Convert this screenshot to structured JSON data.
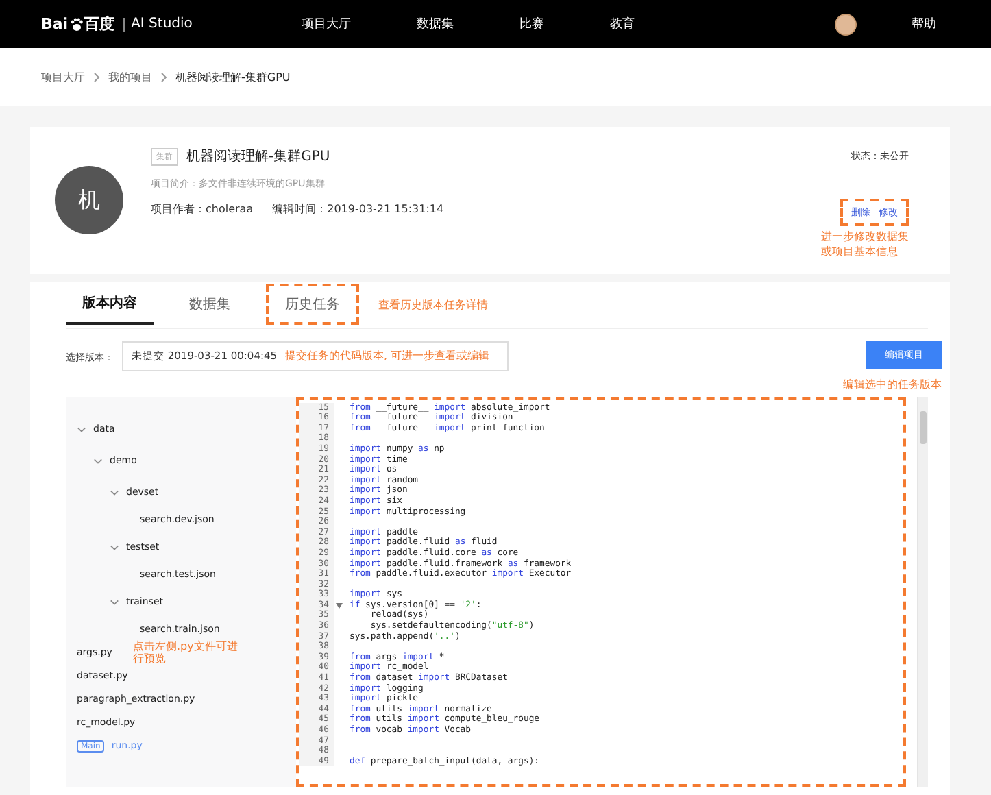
{
  "nav": {
    "logo_left": "Bai",
    "logo_right": "百度",
    "product": "AI Studio",
    "items": [
      {
        "label": "项目大厅",
        "selected": false
      },
      {
        "label": "数据集",
        "selected": false
      },
      {
        "label": "比赛",
        "selected": false
      },
      {
        "label": "教育",
        "selected": false
      }
    ],
    "help": "帮助"
  },
  "breadcrumb": [
    "项目大厅",
    "我的项目",
    "机器阅读理解-集群GPU"
  ],
  "project": {
    "avatar": "机",
    "tag": "集群",
    "title": "机器阅读理解-集群GPU",
    "summary": "项目简介：多文件非连续环境的GPU集群",
    "author": "项目作者：choleraa",
    "edited": "编辑时间：2019-03-21 15:31:14",
    "status": "状态：未公开",
    "actions": [
      "删除",
      "修改"
    ],
    "actions_annotated": true,
    "note_lines": [
      "进一步修改数据集",
      "或项目基本信息"
    ]
  },
  "tabs": [
    {
      "label": "版本内容",
      "selected": true,
      "annotated": false
    },
    {
      "label": "数据集",
      "selected": false,
      "annotated": false
    },
    {
      "label": "历史任务",
      "selected": false,
      "annotated": true
    }
  ],
  "tabs_note": "查看历史版本任务详情",
  "version": {
    "label": "选择版本：",
    "value": "未提交 2019-03-21 00:04:45",
    "note": "提交任务的代码版本, 可进一步查看或编辑",
    "button": "编辑项目",
    "button_note": "编辑选中的任务版本"
  },
  "files": [
    {
      "name": "data",
      "kind": "folder",
      "expanded": true,
      "selected": false,
      "children": [
        {
          "name": "demo",
          "kind": "folder",
          "expanded": true,
          "selected": false,
          "children": [
            {
              "name": "devset",
              "kind": "folder",
              "expanded": true,
              "selected": false,
              "children": [
                {
                  "name": "search.dev.json",
                  "kind": "file",
                  "selected": false
                }
              ]
            },
            {
              "name": "testset",
              "kind": "folder",
              "expanded": true,
              "selected": false,
              "children": [
                {
                  "name": "search.test.json",
                  "kind": "file",
                  "selected": false
                }
              ]
            },
            {
              "name": "trainset",
              "kind": "folder",
              "expanded": true,
              "selected": false,
              "children": [
                {
                  "name": "search.train.json",
                  "kind": "file",
                  "selected": false
                }
              ]
            }
          ]
        }
      ]
    },
    {
      "name": "args.py",
      "kind": "file",
      "selected": false,
      "note": "点击左侧.py文件可进行预览"
    },
    {
      "name": "dataset.py",
      "kind": "file",
      "selected": false
    },
    {
      "name": "paragraph_extraction.py",
      "kind": "file",
      "selected": false
    },
    {
      "name": "rc_model.py",
      "kind": "file",
      "selected": false
    },
    {
      "name": "run.py",
      "kind": "file",
      "selected": true,
      "badge": "Main"
    }
  ],
  "code": {
    "annotated": true,
    "lines": [
      {
        "no": "15",
        "fold": false,
        "tokens": [
          {
            "kind": "keyword",
            "text": "from"
          },
          {
            "kind": "plain",
            "text": " __future__ "
          },
          {
            "kind": "keyword",
            "text": "import"
          },
          {
            "kind": "plain",
            "text": " absolute_import"
          }
        ]
      },
      {
        "no": "16",
        "fold": false,
        "tokens": [
          {
            "kind": "keyword",
            "text": "from"
          },
          {
            "kind": "plain",
            "text": " __future__ "
          },
          {
            "kind": "keyword",
            "text": "import"
          },
          {
            "kind": "plain",
            "text": " division"
          }
        ]
      },
      {
        "no": "17",
        "fold": false,
        "tokens": [
          {
            "kind": "keyword",
            "text": "from"
          },
          {
            "kind": "plain",
            "text": " __future__ "
          },
          {
            "kind": "keyword",
            "text": "import"
          },
          {
            "kind": "plain",
            "text": " print_function"
          }
        ]
      },
      {
        "no": "18",
        "fold": false
      },
      {
        "no": "19",
        "fold": false,
        "tokens": [
          {
            "kind": "keyword",
            "text": "import"
          },
          {
            "kind": "plain",
            "text": " numpy "
          },
          {
            "kind": "keyword",
            "text": "as"
          },
          {
            "kind": "plain",
            "text": " np"
          }
        ]
      },
      {
        "no": "20",
        "fold": false,
        "tokens": [
          {
            "kind": "keyword",
            "text": "import"
          },
          {
            "kind": "plain",
            "text": " time"
          }
        ]
      },
      {
        "no": "21",
        "fold": false,
        "tokens": [
          {
            "kind": "keyword",
            "text": "import"
          },
          {
            "kind": "plain",
            "text": " os"
          }
        ]
      },
      {
        "no": "22",
        "fold": false,
        "tokens": [
          {
            "kind": "keyword",
            "text": "import"
          },
          {
            "kind": "plain",
            "text": " random"
          }
        ]
      },
      {
        "no": "23",
        "fold": false,
        "tokens": [
          {
            "kind": "keyword",
            "text": "import"
          },
          {
            "kind": "plain",
            "text": " json"
          }
        ]
      },
      {
        "no": "24",
        "fold": false,
        "tokens": [
          {
            "kind": "keyword",
            "text": "import"
          },
          {
            "kind": "plain",
            "text": " six"
          }
        ]
      },
      {
        "no": "25",
        "fold": false,
        "tokens": [
          {
            "kind": "keyword",
            "text": "import"
          },
          {
            "kind": "plain",
            "text": " multiprocessing"
          }
        ]
      },
      {
        "no": "26",
        "fold": false
      },
      {
        "no": "27",
        "fold": false,
        "tokens": [
          {
            "kind": "keyword",
            "text": "import"
          },
          {
            "kind": "plain",
            "text": " paddle"
          }
        ]
      },
      {
        "no": "28",
        "fold": false,
        "tokens": [
          {
            "kind": "keyword",
            "text": "import"
          },
          {
            "kind": "plain",
            "text": " paddle.fluid "
          },
          {
            "kind": "keyword",
            "text": "as"
          },
          {
            "kind": "plain",
            "text": " fluid"
          }
        ]
      },
      {
        "no": "29",
        "fold": false,
        "tokens": [
          {
            "kind": "keyword",
            "text": "import"
          },
          {
            "kind": "plain",
            "text": " paddle.fluid.core "
          },
          {
            "kind": "keyword",
            "text": "as"
          },
          {
            "kind": "plain",
            "text": " core"
          }
        ]
      },
      {
        "no": "30",
        "fold": false,
        "tokens": [
          {
            "kind": "keyword",
            "text": "import"
          },
          {
            "kind": "plain",
            "text": " paddle.fluid.framework "
          },
          {
            "kind": "keyword",
            "text": "as"
          },
          {
            "kind": "plain",
            "text": " framework"
          }
        ]
      },
      {
        "no": "31",
        "fold": false,
        "tokens": [
          {
            "kind": "keyword",
            "text": "from"
          },
          {
            "kind": "plain",
            "text": " paddle.fluid.executor "
          },
          {
            "kind": "keyword",
            "text": "import"
          },
          {
            "kind": "plain",
            "text": " Executor"
          }
        ]
      },
      {
        "no": "32",
        "fold": false
      },
      {
        "no": "33",
        "fold": false,
        "tokens": [
          {
            "kind": "keyword",
            "text": "import"
          },
          {
            "kind": "plain",
            "text": " sys"
          }
        ]
      },
      {
        "no": "34",
        "fold": true,
        "tokens": [
          {
            "kind": "keyword",
            "text": "if"
          },
          {
            "kind": "plain",
            "text": " sys.version[0] == "
          },
          {
            "kind": "string",
            "text": "'2'"
          },
          {
            "kind": "plain",
            "text": ":"
          }
        ]
      },
      {
        "no": "35",
        "fold": false,
        "tokens": [
          {
            "kind": "plain",
            "text": "    reload(sys)"
          }
        ]
      },
      {
        "no": "36",
        "fold": false,
        "tokens": [
          {
            "kind": "plain",
            "text": "    sys.setdefaultencoding("
          },
          {
            "kind": "string",
            "text": "\"utf-8\""
          },
          {
            "kind": "plain",
            "text": ")"
          }
        ]
      },
      {
        "no": "37",
        "fold": false,
        "tokens": [
          {
            "kind": "plain",
            "text": "sys.path.append("
          },
          {
            "kind": "string",
            "text": "'..'"
          },
          {
            "kind": "plain",
            "text": ")"
          }
        ]
      },
      {
        "no": "38",
        "fold": false
      },
      {
        "no": "39",
        "fold": false,
        "tokens": [
          {
            "kind": "keyword",
            "text": "from"
          },
          {
            "kind": "plain",
            "text": " args "
          },
          {
            "kind": "keyword",
            "text": "import"
          },
          {
            "kind": "plain",
            "text": " *"
          }
        ]
      },
      {
        "no": "40",
        "fold": false,
        "tokens": [
          {
            "kind": "keyword",
            "text": "import"
          },
          {
            "kind": "plain",
            "text": " rc_model"
          }
        ]
      },
      {
        "no": "41",
        "fold": false,
        "tokens": [
          {
            "kind": "keyword",
            "text": "from"
          },
          {
            "kind": "plain",
            "text": " dataset "
          },
          {
            "kind": "keyword",
            "text": "import"
          },
          {
            "kind": "plain",
            "text": " BRCDataset"
          }
        ]
      },
      {
        "no": "42",
        "fold": false,
        "tokens": [
          {
            "kind": "keyword",
            "text": "import"
          },
          {
            "kind": "plain",
            "text": " logging"
          }
        ]
      },
      {
        "no": "43",
        "fold": false,
        "tokens": [
          {
            "kind": "keyword",
            "text": "import"
          },
          {
            "kind": "plain",
            "text": " pickle"
          }
        ]
      },
      {
        "no": "44",
        "fold": false,
        "tokens": [
          {
            "kind": "keyword",
            "text": "from"
          },
          {
            "kind": "plain",
            "text": " utils "
          },
          {
            "kind": "keyword",
            "text": "import"
          },
          {
            "kind": "plain",
            "text": " normalize"
          }
        ]
      },
      {
        "no": "45",
        "fold": false,
        "tokens": [
          {
            "kind": "keyword",
            "text": "from"
          },
          {
            "kind": "plain",
            "text": " utils "
          },
          {
            "kind": "keyword",
            "text": "import"
          },
          {
            "kind": "plain",
            "text": " compute_bleu_rouge"
          }
        ]
      },
      {
        "no": "46",
        "fold": false,
        "tokens": [
          {
            "kind": "keyword",
            "text": "from"
          },
          {
            "kind": "plain",
            "text": " vocab "
          },
          {
            "kind": "keyword",
            "text": "import"
          },
          {
            "kind": "plain",
            "text": " Vocab"
          }
        ]
      },
      {
        "no": "47",
        "fold": false
      },
      {
        "no": "48",
        "fold": false
      },
      {
        "no": "49",
        "fold": false,
        "tokens": [
          {
            "kind": "keyword",
            "text": "def"
          },
          {
            "kind": "plain",
            "text": " prepare_batch_input(data, args):"
          }
        ]
      }
    ]
  }
}
